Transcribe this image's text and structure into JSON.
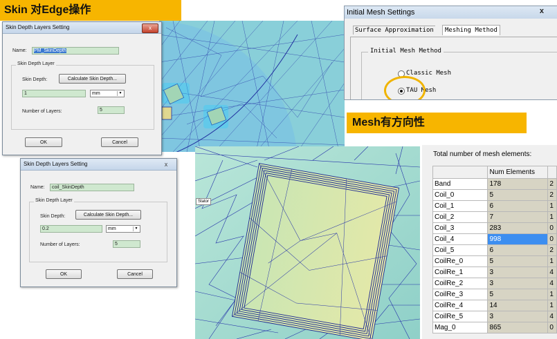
{
  "banners": {
    "skin_edge": "Skin 对Edge操作",
    "mesh_direction": "Mesh有方向性"
  },
  "dialog1": {
    "title": "Skin Depth Layers Setting",
    "close": "x",
    "name_label": "Name:",
    "name_value": "PM_SkinDepth",
    "group_title": "Skin Depth Layer",
    "skin_depth_label": "Skin Depth:",
    "calc_button": "Calculate Skin Depth...",
    "depth_value": "1",
    "unit": "mm",
    "layers_label": "Number of Layers:",
    "layers_value": "5",
    "ok": "OK",
    "cancel": "Cancel"
  },
  "dialog2": {
    "title": "Skin Depth Layers Setting",
    "close": "x",
    "name_label": "Name:",
    "name_value": "coil_SkinDepth",
    "group_title": "Skin Depth Layer",
    "skin_depth_label": "Skin Depth:",
    "calc_button": "Calculate Skin Depth...",
    "depth_value": "0.2",
    "unit": "mm",
    "layers_label": "Number of Layers:",
    "layers_value": "5",
    "ok": "OK",
    "cancel": "Cancel"
  },
  "mesh_settings": {
    "title": "Initial Mesh Settings",
    "close": "x",
    "tabs": [
      "Surface Approximation",
      "Meshing Method"
    ],
    "group_title": "Initial Mesh Method",
    "options": [
      "Classic Mesh",
      "TAU Mesh"
    ],
    "selected": "TAU Mesh"
  },
  "mesh_view": {
    "label": "Stator"
  },
  "mesh_table": {
    "caption": "Total number of mesh elements:",
    "header": "Num Elements",
    "rows": [
      {
        "name": "Band",
        "value": "178",
        "tail": "2"
      },
      {
        "name": "Coil_0",
        "value": "5",
        "tail": "2"
      },
      {
        "name": "Coil_1",
        "value": "6",
        "tail": "1"
      },
      {
        "name": "Coil_2",
        "value": "7",
        "tail": "1"
      },
      {
        "name": "Coil_3",
        "value": "283",
        "tail": "0"
      },
      {
        "name": "Coil_4",
        "value": "998",
        "tail": "0"
      },
      {
        "name": "Coil_5",
        "value": "6",
        "tail": "2"
      },
      {
        "name": "CoilRe_0",
        "value": "5",
        "tail": "1"
      },
      {
        "name": "CoilRe_1",
        "value": "3",
        "tail": "4"
      },
      {
        "name": "CoilRe_2",
        "value": "3",
        "tail": "4"
      },
      {
        "name": "CoilRe_3",
        "value": "5",
        "tail": "1"
      },
      {
        "name": "CoilRe_4",
        "value": "14",
        "tail": "1"
      },
      {
        "name": "CoilRe_5",
        "value": "3",
        "tail": "4"
      },
      {
        "name": "Mag_0",
        "value": "865",
        "tail": "0"
      }
    ],
    "highlight_row": "Coil_4"
  },
  "colors": {
    "banner": "#f7b500",
    "mesh_lines": "#2030a0",
    "mesh_fill": "#8fd6cf",
    "highlight": "#3c8ef0"
  }
}
